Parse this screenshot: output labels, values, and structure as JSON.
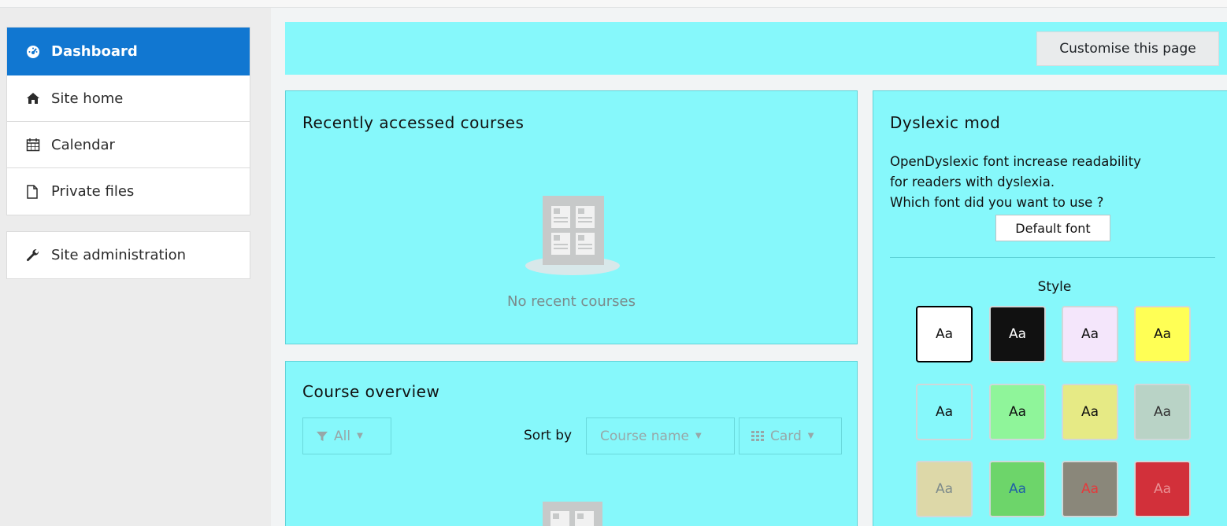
{
  "sidebar": {
    "items": [
      {
        "label": "Dashboard",
        "icon": "dashboard-icon",
        "active": true
      },
      {
        "label": "Site home",
        "icon": "home-icon"
      },
      {
        "label": "Calendar",
        "icon": "calendar-icon"
      },
      {
        "label": "Private files",
        "icon": "file-icon"
      }
    ],
    "admin": {
      "label": "Site administration",
      "icon": "wrench-icon"
    }
  },
  "header": {
    "customise_label": "Customise this page"
  },
  "recent": {
    "title": "Recently accessed courses",
    "empty_text": "No recent courses"
  },
  "overview": {
    "title": "Course overview",
    "filter_label": "All",
    "sort_label": "Sort by",
    "sort_value": "Course name",
    "view_label": "Card"
  },
  "dyslexic": {
    "title": "Dyslexic mod",
    "line1": "OpenDyslexic font increase readability",
    "line2": "for readers with dyslexia.",
    "line3": "Which font did you want to use ?",
    "font_button": "Default font",
    "style_label": "Style",
    "swatches": [
      {
        "label": "Aa",
        "bg": "#ffffff",
        "fg": "#111111",
        "selected": true
      },
      {
        "label": "Aa",
        "bg": "#111111",
        "fg": "#ffffff"
      },
      {
        "label": "Aa",
        "bg": "#f4e6fb",
        "fg": "#111111"
      },
      {
        "label": "Aa",
        "bg": "#ffff55",
        "fg": "#111111"
      },
      {
        "label": "Aa",
        "bg": "#86f8fb",
        "fg": "#111111"
      },
      {
        "label": "Aa",
        "bg": "#8ff59a",
        "fg": "#111111"
      },
      {
        "label": "Aa",
        "bg": "#e6ea85",
        "fg": "#111111"
      },
      {
        "label": "Aa",
        "bg": "#b9d3c6",
        "fg": "#333333"
      },
      {
        "label": "Aa",
        "bg": "#ddd8a8",
        "fg": "#7e8b8b"
      },
      {
        "label": "Aa",
        "bg": "#6dd56a",
        "fg": "#1f5fa8"
      },
      {
        "label": "Aa",
        "bg": "#8a877a",
        "fg": "#e5393b"
      },
      {
        "label": "Aa",
        "bg": "#d2303a",
        "fg": "#e98f93"
      }
    ]
  },
  "colors": {
    "accent": "#1177d1",
    "block_bg": "#86f8fb"
  }
}
